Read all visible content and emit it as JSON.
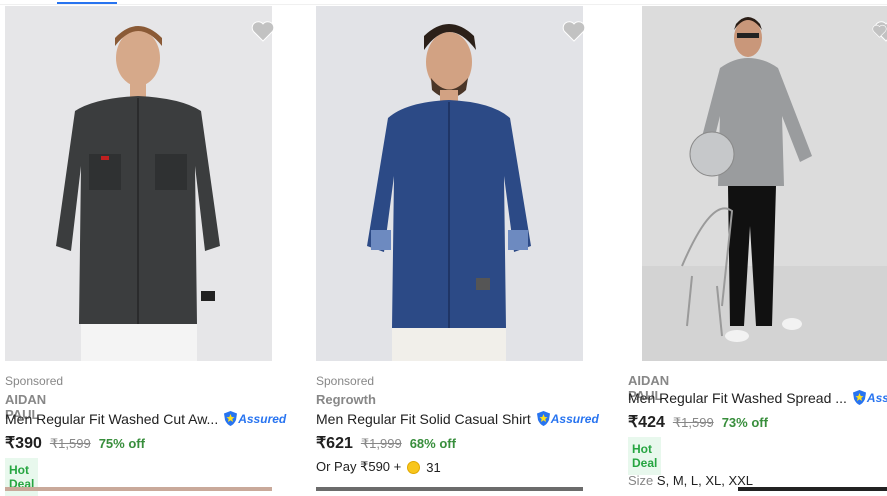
{
  "products": [
    {
      "sponsored": "Sponsored",
      "brand": "AIDAN PAUL",
      "title": "Men Regular Fit Washed Cut Aw...",
      "assured": "Assured",
      "price": "₹390",
      "mrp": "₹1,599",
      "discount": "75% off",
      "badge": "Hot Deal",
      "shirt_color": "#3b3d3e"
    },
    {
      "sponsored": "Sponsored",
      "brand": "Regrowth",
      "title": "Men Regular Fit Solid Casual Shirt",
      "assured": "Assured",
      "price": "₹621",
      "mrp": "₹1,999",
      "discount": "68% off",
      "or_pay": "Or Pay ₹590 +",
      "coins": "31",
      "shirt_color": "#2c4a86"
    },
    {
      "brand": "AIDAN PAUL",
      "title": "Men Regular Fit Washed Spread ...",
      "assured": "Assured",
      "price": "₹424",
      "mrp": "₹1,599",
      "discount": "73% off",
      "badge": "Hot Deal",
      "sizes_label": "Size",
      "sizes": "S, M, L, XL, XXL",
      "shirt_color": "#9a9c9e"
    }
  ],
  "colors": {
    "accent": "#2874f0",
    "discount_green": "#388e3c",
    "muted": "#878787"
  }
}
